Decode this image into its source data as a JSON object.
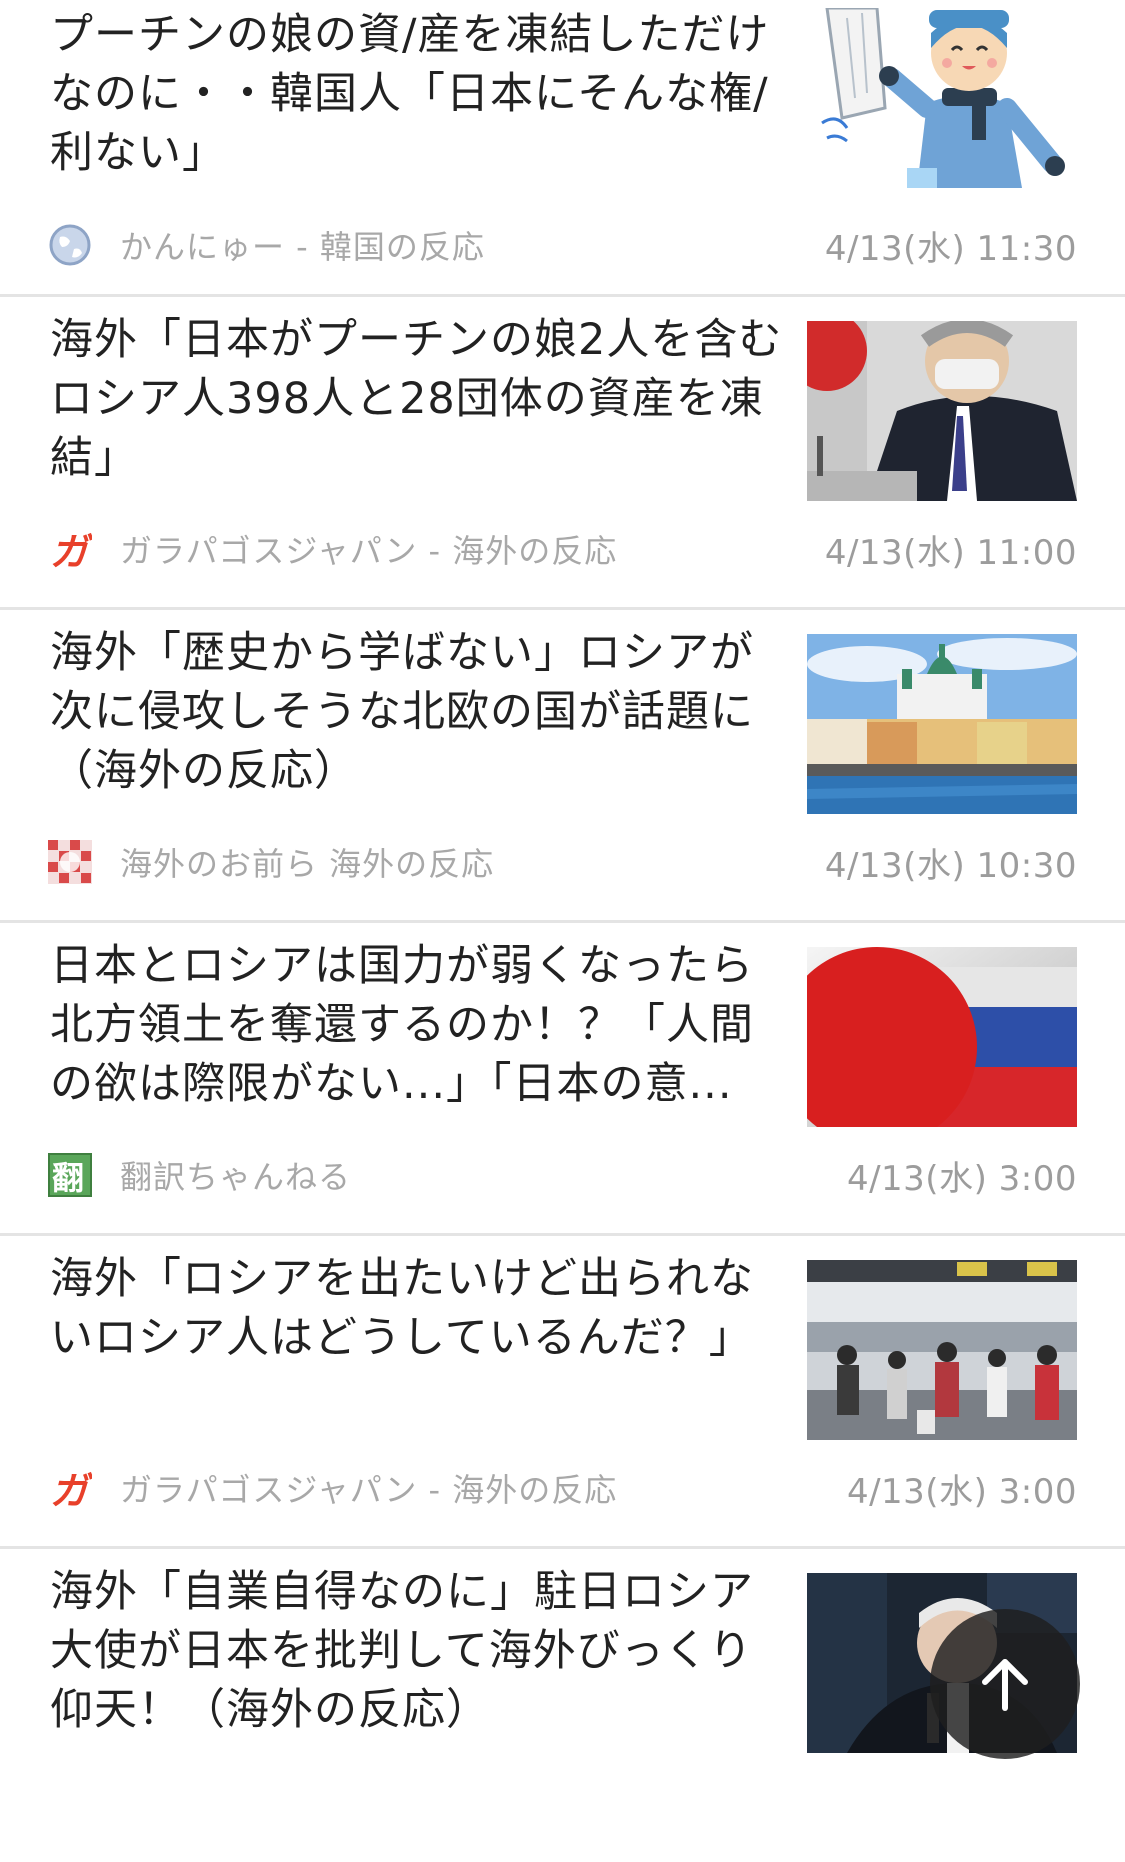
{
  "articles": [
    {
      "headline": "プーチンの娘の資/産を凍結しただけなのに・・韓国人「日本にそんな権/利ない」",
      "source": "かんにゅー - 韓国の反応",
      "date": "4/13(水) 11:30",
      "icon": "globe-icon"
    },
    {
      "headline": "海外「日本がプーチンの娘2人を含むロシア人398人と28団体の資産を凍結」",
      "source": "ガラパゴスジャパン - 海外の反応",
      "date": "4/13(水) 11:00",
      "icon": "ga-logo-icon",
      "icon_text": "ガ"
    },
    {
      "headline": "海外「歴史から学ばない」ロシアが次に侵攻しそうな北欧の国が話題に（海外の反応）",
      "source": "海外のお前ら 海外の反応",
      "date": "4/13(水) 10:30",
      "icon": "mosaic-logo-icon"
    },
    {
      "headline": "日本とロシアは国力が弱くなったら北方領土を奪還するのか！？「人間の欲は際限がない...」「日本の意...",
      "source": "翻訳ちゃんねる",
      "date": "4/13(水) 3:00",
      "icon": "translate-logo-icon",
      "icon_text": "翻"
    },
    {
      "headline": "海外「ロシアを出たいけど出られないロシア人はどうしているんだ？」",
      "source": "ガラパゴスジャパン - 海外の反応",
      "date": "4/13(水) 3:00",
      "icon": "ga-logo-icon",
      "icon_text": "ガ"
    },
    {
      "headline": "海外「自業自得なのに」駐日ロシア大使が日本を批判して海外びっくり仰天！（海外の反応）",
      "source": "",
      "date": "",
      "icon": ""
    }
  ],
  "scroll_top": {
    "icon": "arrow-up-icon"
  },
  "colors": {
    "headline": "#222222",
    "source": "#a8a8a8",
    "date": "#9c9c9c",
    "divider": "#e4e4e4",
    "ga_logo": "#e8402a",
    "translate_logo": "#5aa65a"
  }
}
